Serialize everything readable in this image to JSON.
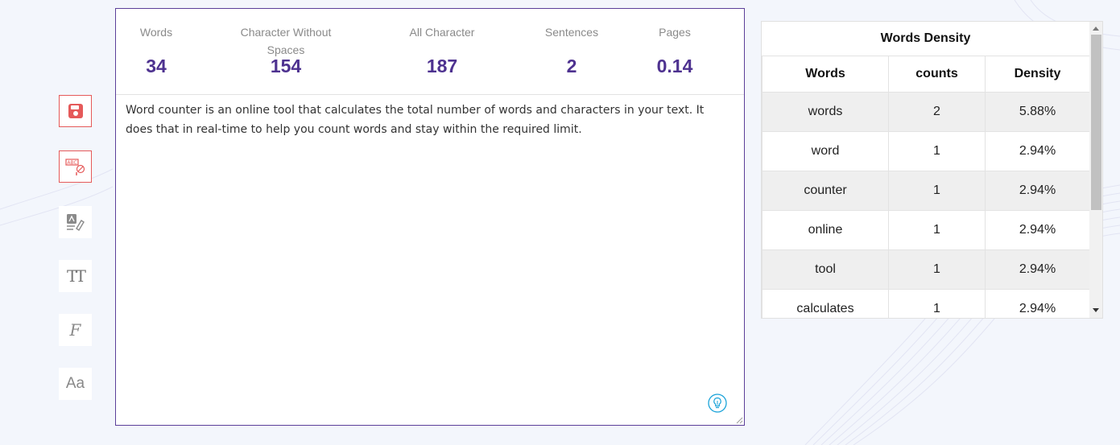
{
  "toolbar": {
    "items": [
      {
        "name": "save-icon",
        "active": true
      },
      {
        "name": "spellcheck-icon",
        "active": true
      },
      {
        "name": "grammar-edit-icon",
        "active": false
      },
      {
        "name": "text-size-icon",
        "active": false
      },
      {
        "name": "font-style-icon",
        "active": false
      },
      {
        "name": "case-icon",
        "active": false
      }
    ],
    "text_size_glyph": "TT",
    "font_glyph": "F",
    "case_glyph": "Aa",
    "spell_glyph": "ABC"
  },
  "stats": {
    "words": {
      "label": "Words",
      "value": "34"
    },
    "chars_no_spaces": {
      "label": "Character Without Spaces",
      "value": "154"
    },
    "all_chars": {
      "label": "All Character",
      "value": "187"
    },
    "sentences": {
      "label": "Sentences",
      "value": "2"
    },
    "pages": {
      "label": "Pages",
      "value": "0.14"
    }
  },
  "editor": {
    "text": "Word counter is an online tool that calculates the total number of words and characters in your text. It does that in real-time to help you count words and stay within the required limit."
  },
  "density": {
    "title": "Words Density",
    "headers": [
      "Words",
      "counts",
      "Density"
    ],
    "rows": [
      [
        "words",
        "2",
        "5.88%"
      ],
      [
        "word",
        "1",
        "2.94%"
      ],
      [
        "counter",
        "1",
        "2.94%"
      ],
      [
        "online",
        "1",
        "2.94%"
      ],
      [
        "tool",
        "1",
        "2.94%"
      ],
      [
        "calculates",
        "1",
        "2.94%"
      ]
    ]
  },
  "colors": {
    "accent": "#4e3290",
    "danger": "#e55a5a",
    "info": "#1aa3d9"
  }
}
